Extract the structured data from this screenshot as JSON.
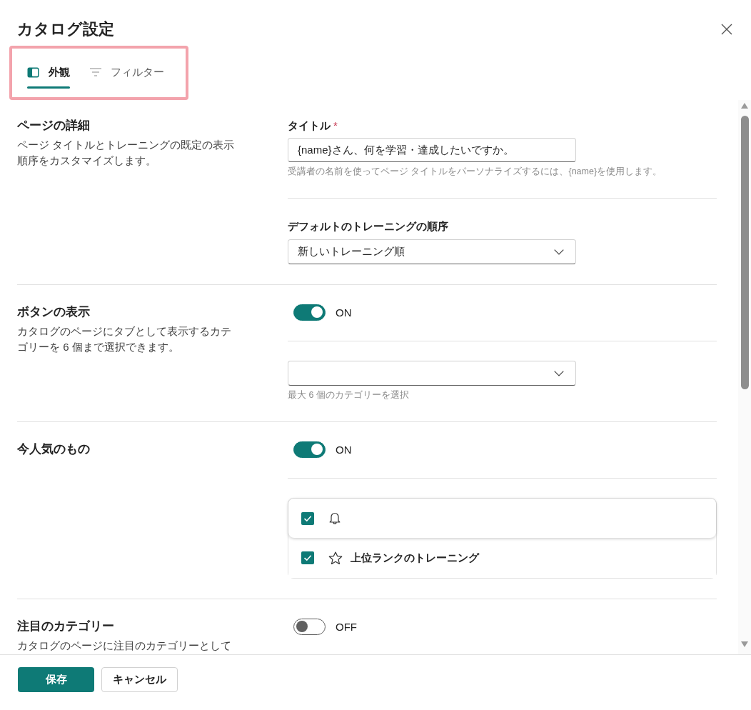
{
  "dialog": {
    "title": "カタログ設定"
  },
  "tab_bar": {
    "highlighted": true,
    "tabs": [
      {
        "label": "外観",
        "selected": true
      },
      {
        "label": "フィルター",
        "selected": false
      }
    ]
  },
  "sections": [
    {
      "heading": "ページの詳細",
      "description": "ページ タイトルとトレーニングの既定の表示順序をカスタマイズします。",
      "fields": [
        {
          "kind": "text",
          "label": "タイトル",
          "required_mark": "*",
          "value": "{name}さん、何を学習・達成したいですか。",
          "hint": "受講者の名前を使ってページ タイトルをパーソナライズするには、{name}を使用します。"
        },
        {
          "kind": "select",
          "label": "デフォルトのトレーニングの順序",
          "value": "新しいトレーニング順"
        }
      ]
    },
    {
      "heading": "ボタンの表示",
      "description": "カタログのページにタブとして表示するカテゴリーを 6 個まで選択できます。",
      "fields": [
        {
          "kind": "toggle",
          "on": true,
          "state_label": "ON"
        },
        {
          "kind": "select",
          "hint": "最大 6 個のカテゴリーを選択"
        }
      ]
    },
    {
      "heading": "今人気のもの",
      "fields": [
        {
          "kind": "toggle",
          "on": true,
          "state_label": "ON"
        },
        {
          "kind": "checklist",
          "items": [
            {
              "checked": true,
              "highlighted": true
            },
            {
              "label": "上位ランクのトレーニング",
              "checked": true,
              "highlighted": false
            }
          ]
        }
      ]
    },
    {
      "heading": "注目のカテゴリー",
      "description": "カタログのページに注目のカテゴリーとして",
      "fields": [
        {
          "kind": "toggle",
          "on": false,
          "state_label": "OFF"
        }
      ]
    }
  ],
  "footer": {
    "buttons": [
      {
        "label": "保存",
        "kind": "primary"
      },
      {
        "label": "キャンセル",
        "kind": "secondary"
      }
    ]
  }
}
